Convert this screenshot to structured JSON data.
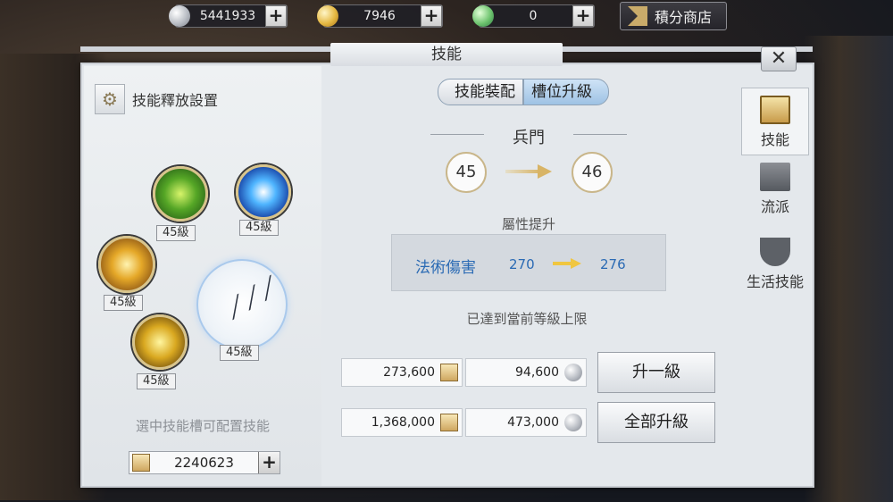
{
  "currencies": {
    "silver": {
      "value": "5441933",
      "plus": "+",
      "icon": "silver-coin-icon"
    },
    "gold": {
      "value": "7946",
      "plus": "+",
      "icon": "gold-ingot-icon"
    },
    "jade": {
      "value": "0",
      "plus": "+",
      "icon": "jade-ingot-icon"
    }
  },
  "shop": {
    "label": "積分商店"
  },
  "panel": {
    "title": "技能",
    "close": "✕"
  },
  "left": {
    "config_label": "技能釋放設置",
    "skills": [
      {
        "level": "45級",
        "icon": "green-tornado-skill-icon"
      },
      {
        "level": "45級",
        "icon": "blue-lightning-skill-icon"
      },
      {
        "level": "45級",
        "icon": "golden-orb-skill-icon"
      },
      {
        "level": "45級",
        "icon": "golden-blade-skill-icon"
      },
      {
        "level": "45級",
        "icon": "claw-strike-skill-icon"
      }
    ],
    "hint": "選中技能槽可配置技能",
    "balance": {
      "value": "2240623",
      "plus": "+"
    }
  },
  "tabs_top": {
    "equip": "技能裝配",
    "upgrade": "槽位升級"
  },
  "slot": {
    "name": "兵門",
    "level_from": "45",
    "level_to": "46",
    "attr_title": "屬性提升",
    "attr_name": "法術傷害",
    "attr_from": "270",
    "attr_to": "276",
    "max_note": "已達到當前等級上限"
  },
  "costs": {
    "one_scroll": "273,600",
    "one_silver": "94,600",
    "all_scroll": "1,368,000",
    "all_silver": "473,000"
  },
  "buttons": {
    "upgrade_one": "升一級",
    "upgrade_all": "全部升級"
  },
  "side_tabs": [
    {
      "label": "技能",
      "icon": "book-icon",
      "active": true
    },
    {
      "label": "流派",
      "icon": "scroll-icon",
      "active": false
    },
    {
      "label": "生活技能",
      "icon": "bowl-icon",
      "active": false
    }
  ],
  "colors": {
    "accent_blue": "#2a6ab4",
    "gold": "#d8b466",
    "panel_bg": "#e4e8ec"
  }
}
